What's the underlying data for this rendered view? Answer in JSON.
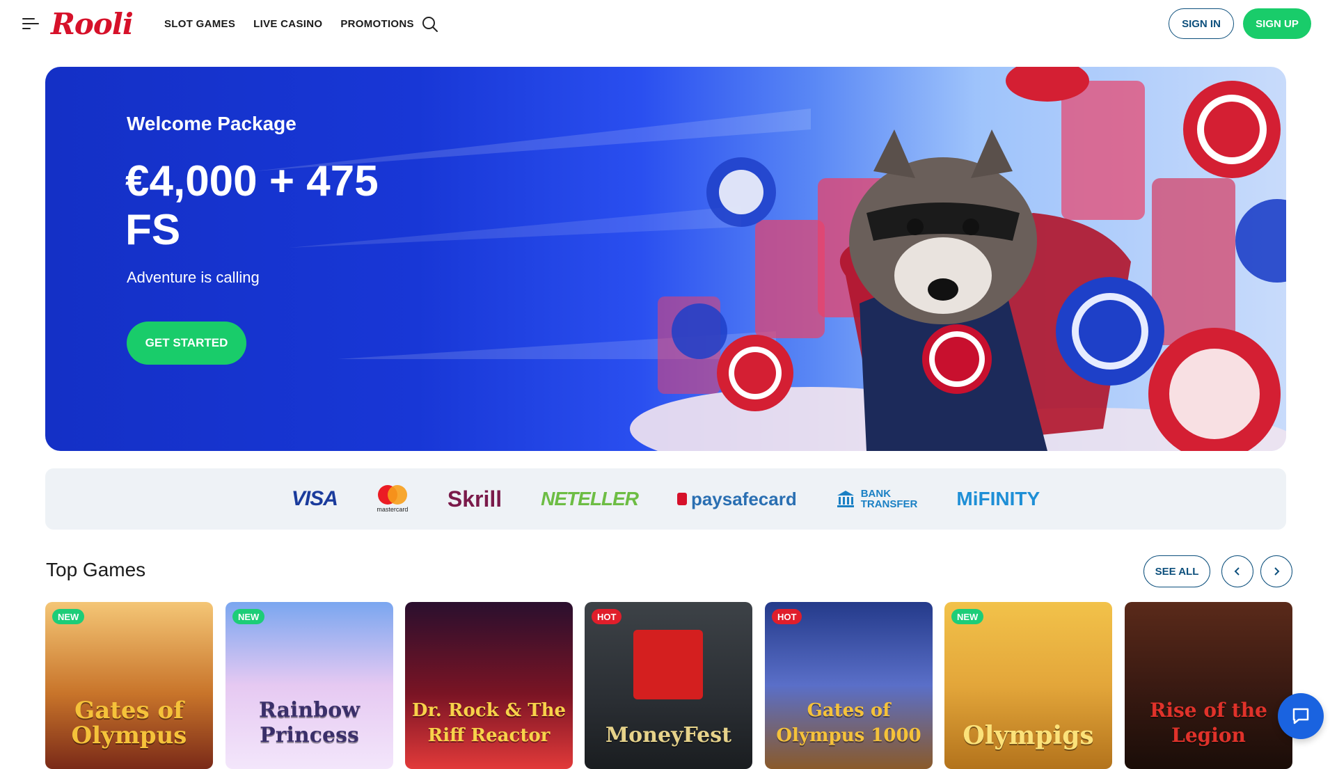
{
  "header": {
    "logo_text": "Rooli",
    "nav": [
      "SLOT GAMES",
      "LIVE CASINO",
      "PROMOTIONS"
    ],
    "sign_in": "SIGN IN",
    "sign_up": "SIGN UP",
    "brand_color": "#d6112a",
    "accent_green": "#19cc6a"
  },
  "hero": {
    "subtitle": "Welcome Package",
    "amount": "€4,000 + 475 FS",
    "tagline": "Adventure is calling",
    "cta": "GET STARTED"
  },
  "payments": {
    "visa": "VISA",
    "mastercard": "mastercard",
    "skrill": "Skrill",
    "neteller": "NETELLER",
    "paysafecard": "paysafecard",
    "bank_line1": "BANK",
    "bank_line2": "TRANSFER",
    "mifinity": "MiFINITY"
  },
  "top_games": {
    "title": "Top Games",
    "see_all": "SEE ALL",
    "prev_icon": "chevron-left-icon",
    "next_icon": "chevron-right-icon",
    "games": [
      {
        "title": "Gates of Olympus",
        "badge": "NEW"
      },
      {
        "title": "Rainbow Princess",
        "badge": "NEW"
      },
      {
        "title": "Dr. Rock & The Riff Reactor",
        "badge": ""
      },
      {
        "title": "MoneyFest",
        "badge": "HOT"
      },
      {
        "title": "Gates of Olympus 1000",
        "badge": "HOT"
      },
      {
        "title": "Olympigs",
        "badge": "NEW"
      },
      {
        "title": "Rise of the Legion",
        "badge": ""
      }
    ]
  },
  "chat": {
    "icon": "chat-icon"
  }
}
